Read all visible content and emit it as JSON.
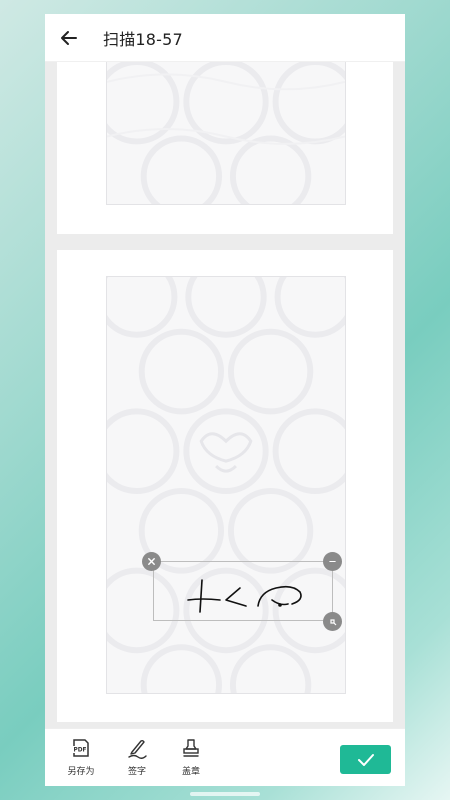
{
  "header": {
    "back_icon": "arrow-left-icon",
    "title": "扫描18-57"
  },
  "pages": [
    {
      "name": "page-1"
    },
    {
      "name": "page-2"
    }
  ],
  "signature_overlay": {
    "close_icon": "close-icon",
    "rotate_icon": "rotate-handle-icon",
    "resize_icon": "resize-handle-icon"
  },
  "toolbar": {
    "save_as_label": "另存为",
    "save_as_icon": "pdf-file-icon",
    "save_as_icon_text": "PDF",
    "sign_label": "签字",
    "sign_icon": "pen-sign-icon",
    "stamp_label": "盖章",
    "stamp_icon": "stamp-icon",
    "confirm_icon": "check-icon"
  },
  "colors": {
    "accent": "#1fb996",
    "header_bg": "#ffffff",
    "page_bg": "#ececec"
  }
}
